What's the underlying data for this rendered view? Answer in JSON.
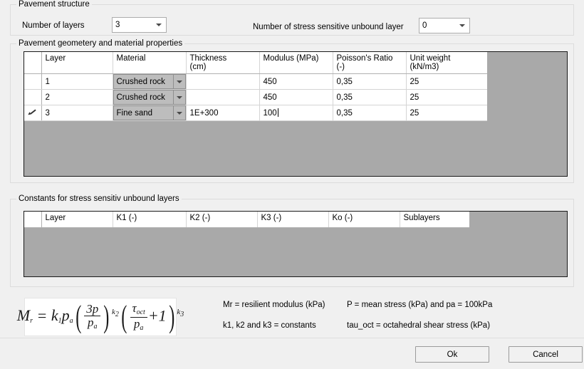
{
  "pavement_structure": {
    "group_title": "Pavement structure",
    "number_of_layers_label": "Number of layers",
    "number_of_layers_value": "3",
    "stress_sensitive_label": "Number of stress sensitive unbound layer",
    "stress_sensitive_value": "0"
  },
  "geometry": {
    "group_title": "Pavement geometery and material properties",
    "columns": [
      "",
      "Layer",
      "Material",
      "Thickness (cm)",
      "Modulus (MPa)",
      "Poisson's Ratio (-)",
      "Unit weight (kN/m3)"
    ],
    "columns_split": [
      {
        "line1": "",
        "line2": ""
      },
      {
        "line1": "Layer",
        "line2": ""
      },
      {
        "line1": "Material",
        "line2": ""
      },
      {
        "line1": "Thickness",
        "line2": "(cm)"
      },
      {
        "line1": "Modulus (MPa)",
        "line2": ""
      },
      {
        "line1": "Poisson's Ratio (-)",
        "line2": ""
      },
      {
        "line1": "Unit weight",
        "line2": "(kN/m3)"
      }
    ],
    "rows": [
      {
        "marker": "",
        "layer": "1",
        "material": "Crushed rock",
        "thickness": "",
        "modulus": "450",
        "poisson": "0,35",
        "unit_weight": "25",
        "editing": false
      },
      {
        "marker": "",
        "layer": "2",
        "material": "Crushed rock",
        "thickness": "",
        "modulus": "450",
        "poisson": "0,35",
        "unit_weight": "25",
        "editing": false
      },
      {
        "marker": "pencil-icon",
        "layer": "3",
        "material": "Fine sand",
        "thickness": "1E+300",
        "modulus": "100",
        "poisson": "0,35",
        "unit_weight": "25",
        "editing": true
      }
    ]
  },
  "constants": {
    "group_title": "Constants for stress sensitiv unbound layers",
    "columns": [
      "",
      "Layer",
      "K1 (-)",
      "K2 (-)",
      "K3 (-)",
      "Ko (-)",
      "Sublayers"
    ],
    "rows": []
  },
  "formula": {
    "mr": "M",
    "mr_sub": "r",
    "equals": "=",
    "k1": "k",
    "k1_sub": "1",
    "pa": "p",
    "pa_sub": "a",
    "num1": "3p",
    "den1": "p",
    "den1_sub": "a",
    "exp1": "k",
    "exp1_sub": "2",
    "num2": "τ",
    "num2_sub": "oct",
    "den2": "p",
    "den2_sub": "a",
    "plus1": "+ 1",
    "exp2": "k",
    "exp2_sub": "3",
    "plain": "Mr = k1*pa*(3p/pa)^k2*(tau_oct/pa + 1)^k3"
  },
  "legend": {
    "left": [
      "Mr = resilient modulus (kPa)",
      "k1, k2 and k3 = constants"
    ],
    "right": [
      "P = mean stress (kPa) and pa = 100kPa",
      "tau_oct = octahedral shear stress (kPa)"
    ]
  },
  "footer": {
    "ok_label": "Ok",
    "cancel_label": "Cancel"
  },
  "colors": {
    "window_background": "#f0f0f0",
    "grid_background": "#a9a9a9",
    "grid_border": "#1a1a1a",
    "cell_background": "#ffffff",
    "combo_cell_background": "#bdbdbd",
    "group_border": "#dcdcdc"
  }
}
